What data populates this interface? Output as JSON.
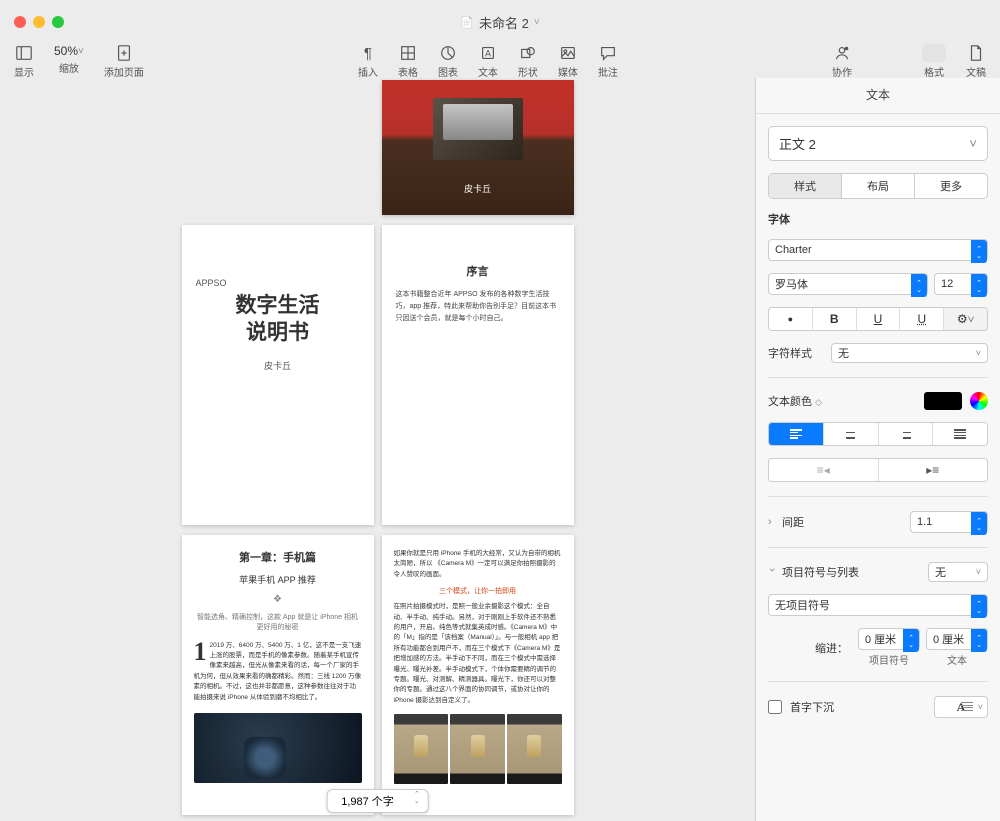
{
  "window": {
    "title": "未命名 2"
  },
  "toolbar": {
    "left": [
      {
        "name": "view",
        "label": "显示"
      },
      {
        "name": "zoom",
        "label": "缩放",
        "value": "50%"
      },
      {
        "name": "add-page",
        "label": "添加页面"
      }
    ],
    "center": [
      {
        "name": "insert",
        "label": "插入"
      },
      {
        "name": "table",
        "label": "表格"
      },
      {
        "name": "chart",
        "label": "图表"
      },
      {
        "name": "text",
        "label": "文本"
      },
      {
        "name": "shape",
        "label": "形状"
      },
      {
        "name": "media",
        "label": "媒体"
      },
      {
        "name": "comment",
        "label": "批注"
      }
    ],
    "right": [
      {
        "name": "collaborate",
        "label": "协作"
      },
      {
        "name": "format",
        "label": "格式"
      },
      {
        "name": "document",
        "label": "文稿"
      }
    ]
  },
  "pages": {
    "p1_caption": "皮卡丘",
    "p2_appso": "APPSO",
    "p2_title_l1": "数字生活",
    "p2_title_l2": "说明书",
    "p2_author": "皮卡丘",
    "p3_title": "序言",
    "p3_body": "这本书籍整合近年 APPSO 发布的各种数字生活技巧，app 推荐，特此来帮助你告别手足？目前这本书只因送个会员，就是每个小时自己。",
    "p4_h1": "第一章：手机篇",
    "p4_h2": "苹果手机 APP 推荐",
    "p4_lead": "智能选角、精确控制，这款 App 就是让 iPhone 相机更好用的秘密",
    "p4_para": "2019 万、6400 万、5400 万、1 亿，这不是一支飞速上涨的股票，而是手机的像素参数。随着某手机宣传像素来越高，但光从像素来看的话，每一个厂家的手机为何，但从效果来看的确都精彩。然而：三线 1200 万像素的相机。不过，这也并非都愿意，这种参数往往对于功能拍摄来说 iPhone 从体验到磨不均相比了。",
    "p5_body1": "如果你就是只用 iPhone 手机的大经常，又认为自带的相机太简陋，所以 《Camera M》一定可以满足你拍照摄影的令人赞叹的画面。",
    "p5_red": "三个模式，让你一拍即用",
    "p5_body2": "在照片拍摄模式时，是照一般业余摄影这个模式：全自动、半手动、纯手动。另然，对于刚刚上手软件还不熟悉的用户，开启。纯色等式就集英成时感。《Camera M》中的「M」指的是「该档案（Manual）」。与一般相机 app 把所有功能都合到用户不，而在三个模式下《Camera M》是把增加感的方法。半手动下不同，而在三个模式中需选择曝光、曝光补差。半手动模式下，个体你需要精的调节的专题。曝光、对测解、精测器具。曝光下，你还可以对整你的专题。通过这八个界面的协同调节，或协对让你的 iPhone 摄影达到自定义了。",
    "wordcount": "1,987 个字"
  },
  "inspector": {
    "title": "文本",
    "paragraph_style": "正文 2",
    "tabs": {
      "style": "样式",
      "layout": "布局",
      "more": "更多"
    },
    "font_section": "字体",
    "font_family": "Charter",
    "font_typeface": "罗马体",
    "font_size": "12",
    "char_style_label": "字符样式",
    "char_style_value": "无",
    "text_color_label": "文本颜色",
    "spacing_label": "间距",
    "spacing_value": "1.1",
    "bullets_label": "项目符号与列表",
    "bullets_value": "无",
    "bullets_style": "无项目符号",
    "indent_label": "缩进：",
    "indent_bullet": "0 厘米",
    "indent_text": "0 厘米",
    "indent_bullet_cap": "项目符号",
    "indent_text_cap": "文本",
    "dropcap_label": "首字下沉"
  }
}
